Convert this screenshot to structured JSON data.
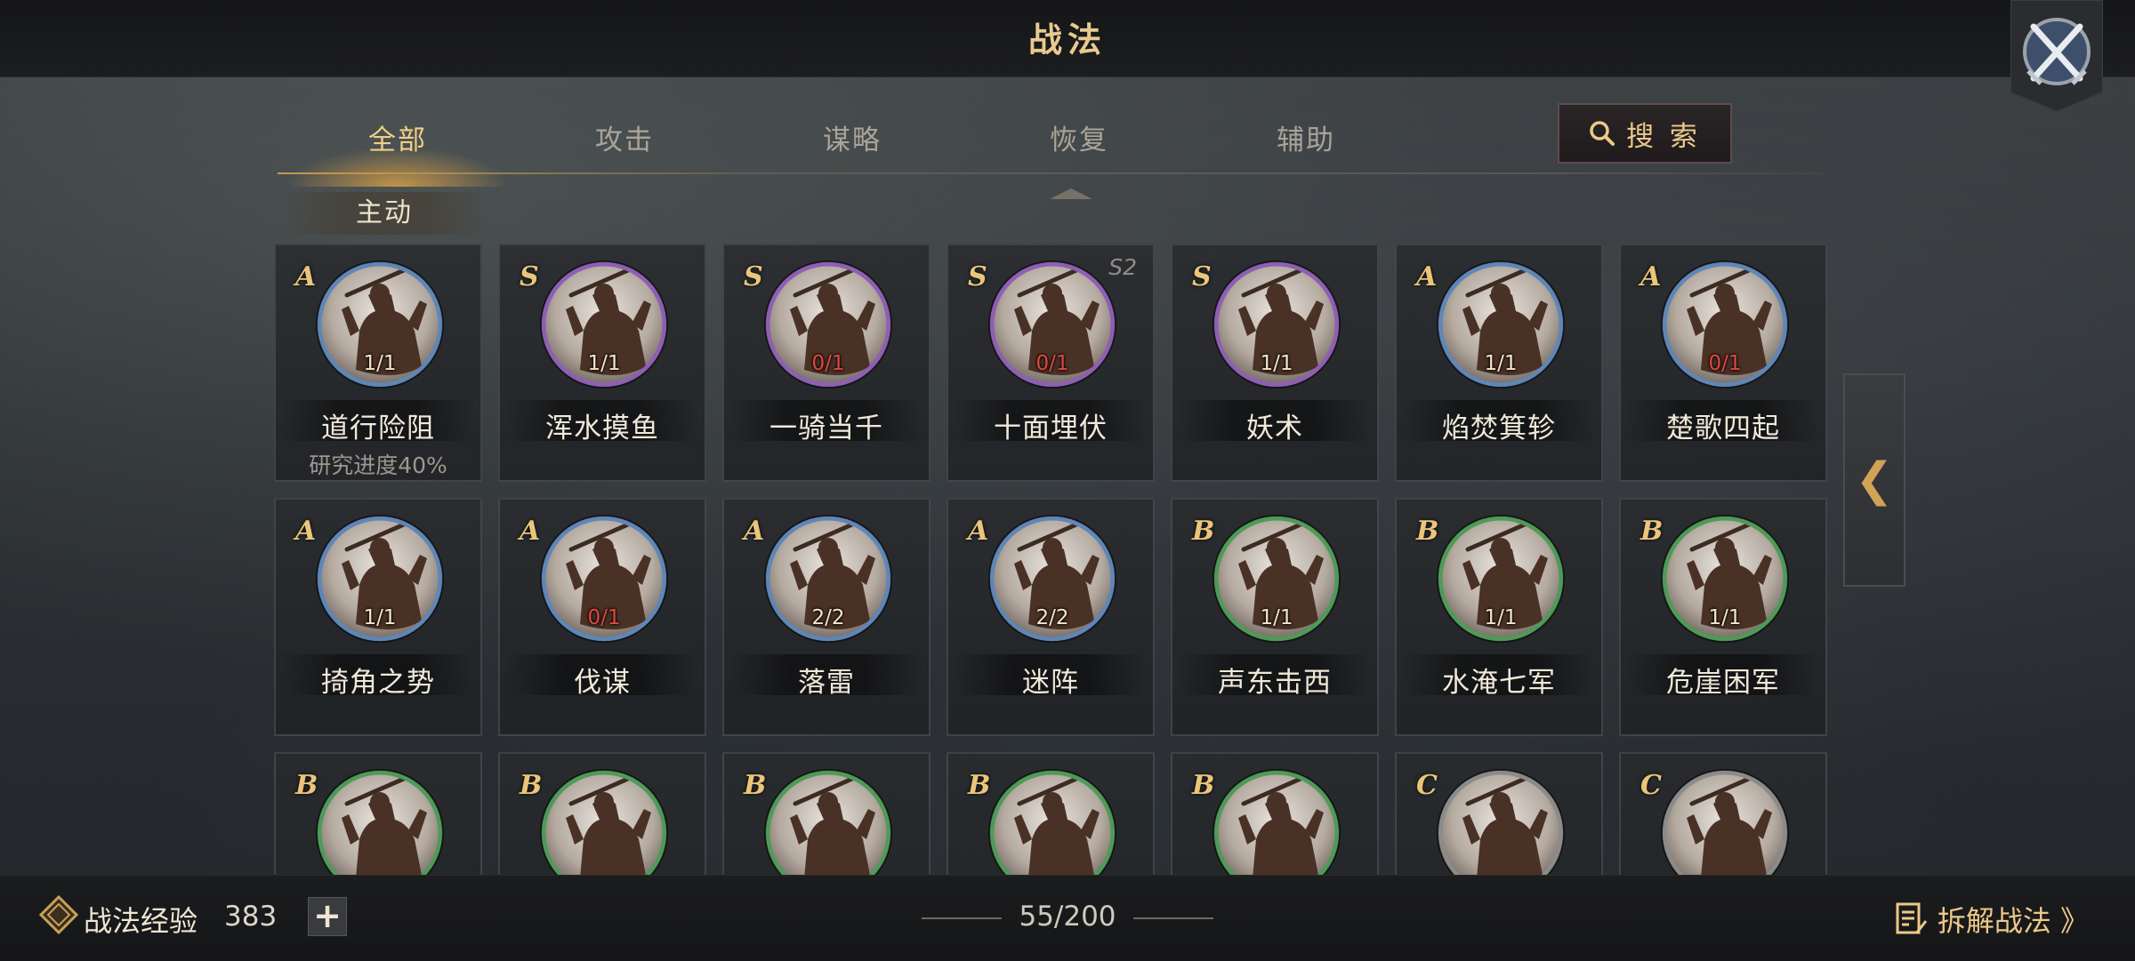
{
  "header": {
    "title": "战法"
  },
  "tabs": [
    {
      "label": "全部",
      "active": true
    },
    {
      "label": "攻击",
      "active": false
    },
    {
      "label": "谋略",
      "active": false
    },
    {
      "label": "恢复",
      "active": false
    },
    {
      "label": "辅助",
      "active": false
    }
  ],
  "search": {
    "label": "搜 索"
  },
  "section": {
    "label": "主动"
  },
  "grade_colors": {
    "S": "#8e5fb4",
    "A": "#5f86b6",
    "B": "#4f9a57",
    "C": "#8b8b8b"
  },
  "cards": [
    {
      "grade": "A",
      "count": "1/1",
      "zero": false,
      "name": "道行险阻",
      "sub": "研究进度40%"
    },
    {
      "grade": "S",
      "count": "1/1",
      "zero": false,
      "name": "浑水摸鱼"
    },
    {
      "grade": "S",
      "count": "0/1",
      "zero": true,
      "name": "一骑当千"
    },
    {
      "grade": "S",
      "count": "0/1",
      "zero": true,
      "name": "十面埋伏",
      "season": "S2"
    },
    {
      "grade": "S",
      "count": "1/1",
      "zero": false,
      "name": "妖术"
    },
    {
      "grade": "A",
      "count": "1/1",
      "zero": false,
      "name": "焰焚箕轸"
    },
    {
      "grade": "A",
      "count": "0/1",
      "zero": true,
      "name": "楚歌四起"
    },
    {
      "grade": "A",
      "count": "1/1",
      "zero": false,
      "name": "掎角之势"
    },
    {
      "grade": "A",
      "count": "0/1",
      "zero": true,
      "name": "伐谋"
    },
    {
      "grade": "A",
      "count": "2/2",
      "zero": false,
      "name": "落雷"
    },
    {
      "grade": "A",
      "count": "2/2",
      "zero": false,
      "name": "迷阵"
    },
    {
      "grade": "B",
      "count": "1/1",
      "zero": false,
      "name": "声东击西"
    },
    {
      "grade": "B",
      "count": "1/1",
      "zero": false,
      "name": "水淹七军"
    },
    {
      "grade": "B",
      "count": "1/1",
      "zero": false,
      "name": "危崖困军"
    },
    {
      "grade": "B"
    },
    {
      "grade": "B"
    },
    {
      "grade": "B"
    },
    {
      "grade": "B"
    },
    {
      "grade": "B"
    },
    {
      "grade": "C"
    },
    {
      "grade": "C"
    }
  ],
  "side_toggle": {
    "glyph": "❮"
  },
  "footer": {
    "exp_label": "战法经验",
    "exp_value": "383",
    "plus_glyph": "+",
    "capacity": "55/200",
    "decompose_label": "拆解战法 》"
  }
}
